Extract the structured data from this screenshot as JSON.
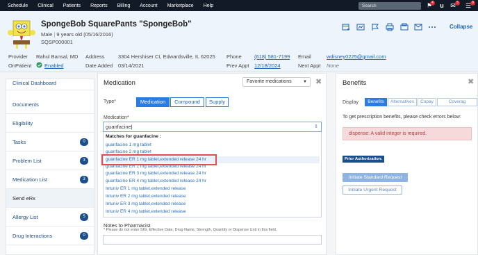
{
  "nav": {
    "items": [
      "Schedule",
      "Clinical",
      "Patients",
      "Reports",
      "Billing",
      "Account",
      "Marketplace",
      "Help"
    ],
    "search_placeholder": "Search",
    "badges": [
      "4",
      "5",
      "8"
    ]
  },
  "patient": {
    "name": "SpongeBob SquarePants \"SpongeBob\"",
    "sex": "Male",
    "age_dob": "9 years old (05/16/2016)",
    "id": "SQSP000001",
    "provider_label": "Provider",
    "provider": "Rahul Bansal, MD",
    "onpatient_label": "OnPatient",
    "onpatient": "Enabled",
    "address_label": "Address",
    "address": "3304 Hershiser Ct, Edwardsville, IL 62025",
    "date_added_label": "Date Added",
    "date_added": "03/14/2021",
    "phone_label": "Phone",
    "phone": "(618) 581-7199",
    "prev_appt_label": "Prev Appt",
    "prev_appt": "12/18/2024",
    "email_label": "Email",
    "email": "wdisney0225@gmail.com",
    "next_appt_label": "Next Appt",
    "next_appt": "None",
    "collapse": "Collapse"
  },
  "sidebar": {
    "items": [
      {
        "label": "Clinical Dashboard"
      },
      {
        "label": "Documents"
      },
      {
        "label": "Eligibility"
      },
      {
        "label": "Tasks",
        "count": "0"
      },
      {
        "label": "Problem List",
        "count": "3"
      },
      {
        "label": "Medication List",
        "count": "3"
      },
      {
        "label": "Send eRx"
      },
      {
        "label": "Allergy List",
        "count": "5"
      },
      {
        "label": "Drug Interactions",
        "count": "0"
      }
    ]
  },
  "medication": {
    "title": "Medication",
    "favorites": "Favorite medications",
    "type_label": "Type*",
    "types": [
      "Medication",
      "Compound",
      "Supply"
    ],
    "med_label": "Medication*",
    "med_value": "guanfacine",
    "matches_header": "Matches for guanfacine :",
    "matches": [
      "guanfacine 1 mg tablet",
      "guanfacine 2 mg tablet",
      "guanfacine ER 1 mg tablet,extended release 24 hr",
      "guanfacine ER 2 mg tablet,extended release 24 hr",
      "guanfacine ER 3 mg tablet,extended release 24 hr",
      "guanfacine ER 4 mg tablet,extended release 24 hr",
      "Intuniv ER 1 mg tablet,extended release",
      "Intuniv ER 2 mg tablet,extended release",
      "Intuniv ER 3 mg tablet,extended release",
      "Intuniv ER 4 mg tablet,extended release"
    ],
    "notes_label": "Notes to Pharmacist",
    "notes_hint": "* Please do not enter SIG, Effective Date, Drug Name, Strength, Quantity or Dispense Unit in this field."
  },
  "benefits": {
    "title": "Benefits",
    "display_label": "Display",
    "tabs": [
      "Benefits",
      "Alternatives",
      "Copay",
      "Coverag"
    ],
    "message": "To get prescription benefits, please check errors below:",
    "error": "dispense: A valid integer is required.",
    "prior_auth": "Prior Authorization:",
    "btn_standard": "Initiate Standard Request",
    "btn_urgent": "Initiate Urgent Request"
  }
}
